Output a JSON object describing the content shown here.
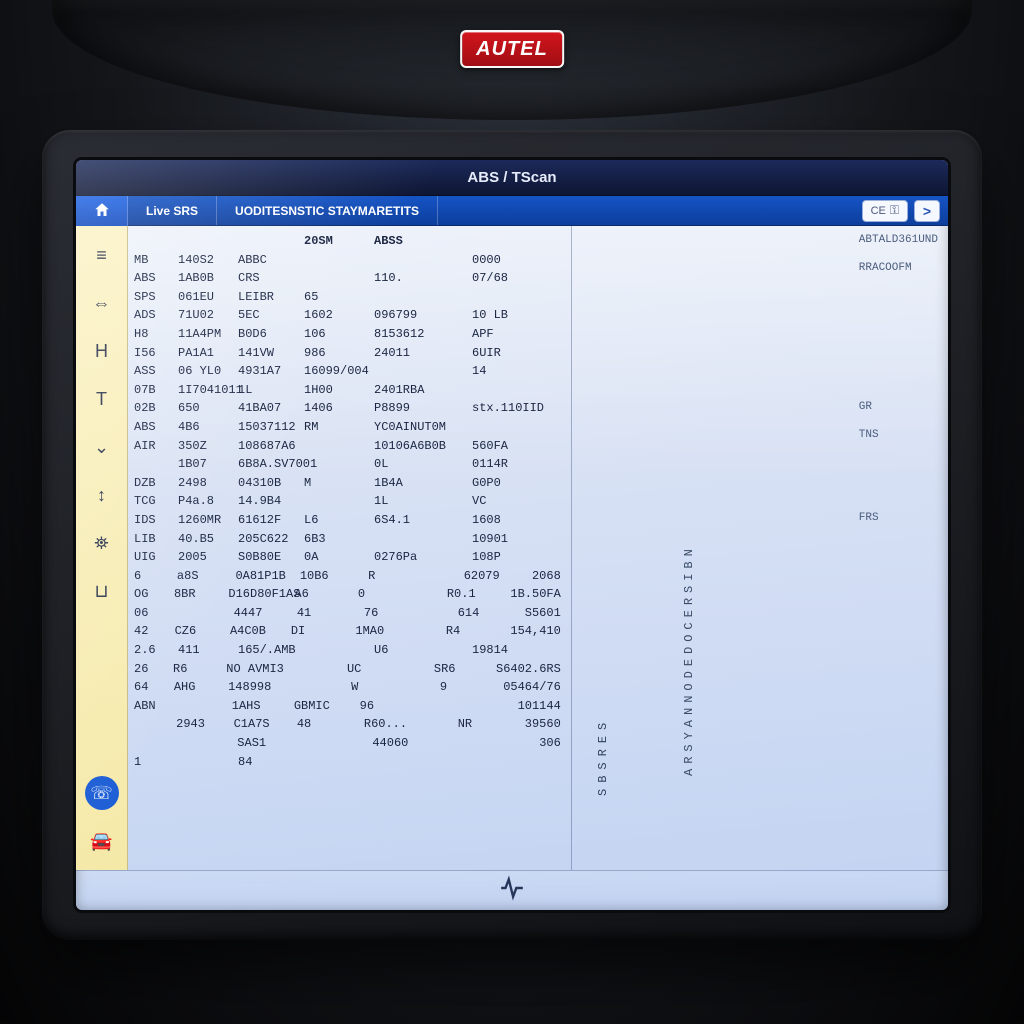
{
  "brand": "AUTEL",
  "titlebar": "ABS / TScan",
  "tabs": {
    "live": "Live SRS",
    "diag": "UODITESNSTIC STAYMARETITS"
  },
  "toolbar": {
    "ce_badge": "CE",
    "arrow": ">"
  },
  "rightpane": {
    "top1": "ABTALD361UND",
    "top2": "RRACOOFM",
    "mid1": "GR",
    "mid2": "TNS",
    "mid3": "FRS",
    "vlabel1": "SBSRES",
    "vlabel2": "ARSYANNODEDOCERSIBN"
  },
  "headers": [
    "",
    "",
    "",
    "20SM",
    "ABSS",
    ""
  ],
  "rows": [
    [
      "MB",
      "140S2",
      "ABBC",
      "",
      "",
      "0000"
    ],
    [
      "ABS",
      "1AB0B",
      "CRS",
      "",
      "110.",
      "07/68"
    ],
    [
      "SPS",
      "061EU",
      "LEIBR",
      "65",
      "",
      ""
    ],
    [
      "ADS",
      "71U02",
      "5EC",
      "1602",
      "096799",
      "10 LB"
    ],
    [
      "H8",
      "11A4PM",
      "B0D6",
      "106",
      "8153612",
      "APF"
    ],
    [
      "I56",
      "PA1A1",
      "141VW",
      "986",
      "24011",
      "6UIR"
    ],
    [
      "ASS",
      "06 YL0",
      "4931A7",
      "16099/004",
      "",
      "14"
    ],
    [
      "07B",
      "1I7041011",
      "1L",
      "1H00",
      "2401RBA",
      ""
    ],
    [
      "02B",
      "650",
      "41BA07",
      "1406",
      "P8899",
      "stx.110IID"
    ],
    [
      "ABS",
      "4B6",
      "15037112",
      "RM",
      "YC0AINUT0M",
      ""
    ],
    [
      "AIR",
      "350Z",
      "108687A6",
      "",
      "10106A6B0B",
      "560FA"
    ],
    [
      "",
      "1B07",
      "6B8A.SV7001",
      "",
      "0L",
      "0114R"
    ],
    [
      "DZB",
      "2498",
      "04310B",
      "M",
      "1B4A",
      "G0P0"
    ],
    [
      "TCG",
      "P4a.8",
      "14.9B4",
      "",
      "1L",
      "VC"
    ],
    [
      "IDS",
      "1260MR",
      "61612F",
      "L6",
      "6S4.1",
      "1608"
    ],
    [
      "LIB",
      "40.B5",
      "205C622",
      "6B3",
      "",
      "10901"
    ],
    [
      "UIG",
      "2005",
      "S0B80E",
      "0A",
      "0276Pa",
      "108P"
    ],
    [
      "6",
      "a8S",
      "0A81P1B",
      "10B6",
      "R",
      "62079",
      "2068"
    ],
    [
      "OG",
      "8BR",
      "D16D80F1AS",
      "A6",
      "0",
      "R0.1",
      "1B.50FA"
    ],
    [
      "06",
      "",
      "4447",
      "41",
      "76",
      "614",
      "S5601"
    ],
    [
      "42",
      "CZ6",
      "A4C0B",
      "DI",
      "1MA0",
      "R4",
      "154,410"
    ],
    [
      "2.6",
      "411",
      "165/.AMB",
      "",
      "U6",
      "19814",
      ""
    ],
    [
      "26",
      "R6",
      "NO AVMI3",
      "",
      "UC",
      "SR6",
      "S6402.6RS"
    ],
    [
      "64",
      "AHG",
      "148998",
      "",
      "W",
      "9",
      "05464/76"
    ],
    [
      "ABN",
      "",
      "1AHS",
      "GBMIC",
      "96",
      "",
      "101144"
    ],
    [
      "",
      "2943",
      "C1A7S",
      "48",
      "R60...",
      "NR",
      "39560"
    ],
    [
      "",
      "",
      "SAS1",
      "",
      "44060",
      "",
      "306"
    ],
    [
      "1",
      "",
      "84",
      "",
      "",
      "",
      ""
    ]
  ]
}
